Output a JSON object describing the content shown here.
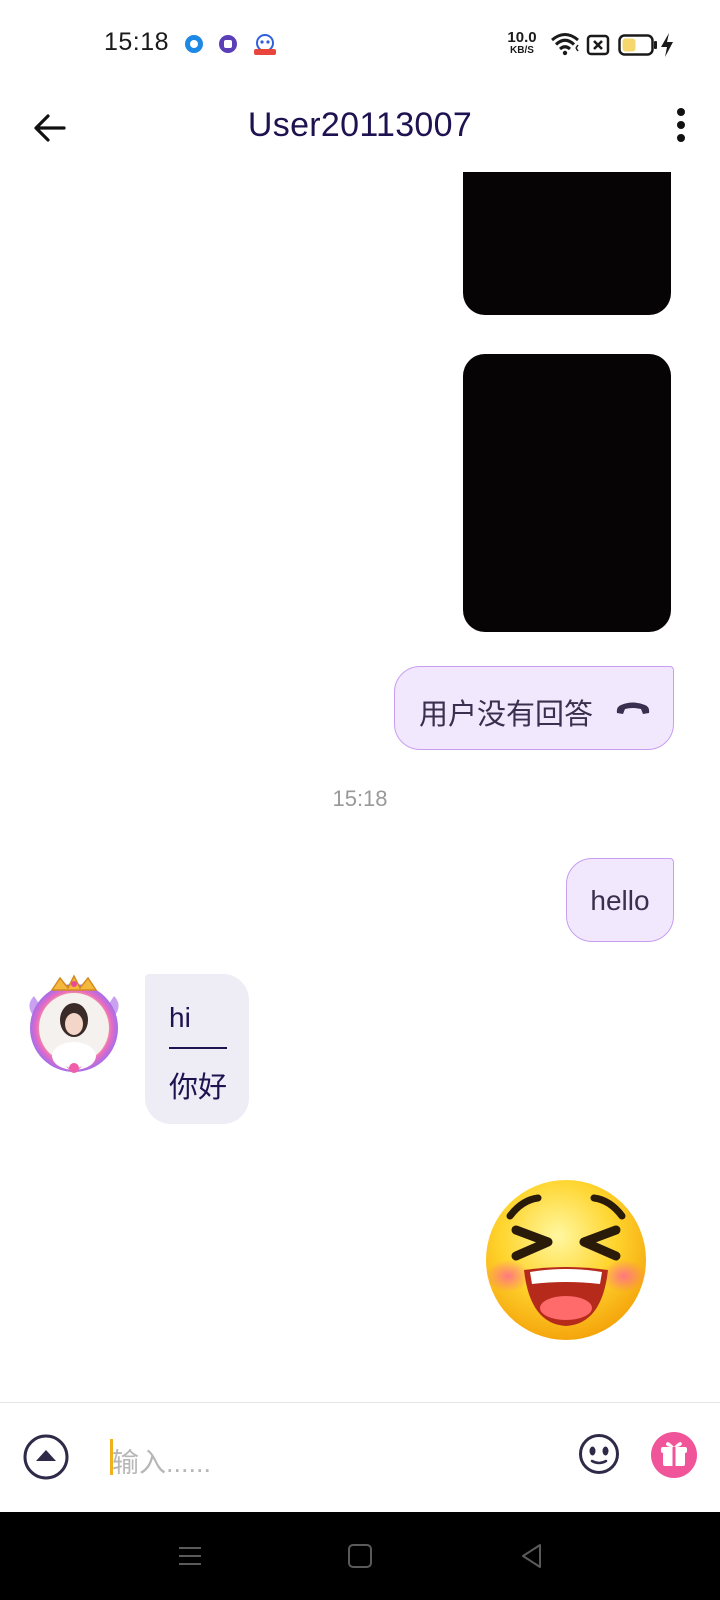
{
  "status_bar": {
    "time": "15:18",
    "net_speed": "10.0",
    "net_unit": "KB/S",
    "notification_icons": [
      "circle-app-icon",
      "square-app-icon",
      "baidu-app-icon"
    ],
    "indicators": [
      "wifi-icon",
      "sim-off-icon",
      "battery-icon",
      "charging-icon"
    ],
    "battery_color": "#f5d76e"
  },
  "header": {
    "title": "User20113007",
    "back_icon": "arrow-left-icon",
    "menu_icon": "more-vertical-icon"
  },
  "messages": {
    "call_status": "用户没有回答",
    "call_icon": "phone-hangup-icon",
    "time_separator": "15:18",
    "outgoing_text": "hello",
    "incoming_original": "hi",
    "incoming_translation": "你好",
    "sticker": "laughing-emoji-sticker"
  },
  "input_bar": {
    "placeholder": "输入......",
    "more_icon": "expand-up-icon",
    "emoji_icon": "smiley-icon",
    "gift_icon": "gift-icon"
  },
  "colors": {
    "title": "#1e1250",
    "outgoing_bubble": "#f1e8fd",
    "outgoing_border": "#c89df2",
    "incoming_bubble": "#eeedf6",
    "caret": "#f2b01e",
    "gift": "#f0559a"
  }
}
